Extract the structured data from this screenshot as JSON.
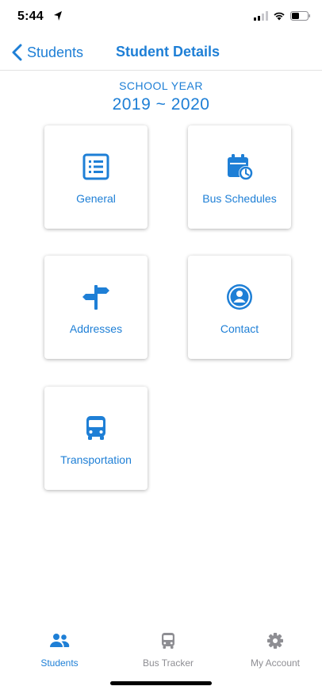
{
  "status_bar": {
    "time": "5:44"
  },
  "nav": {
    "back_label": "Students",
    "title": "Student Details"
  },
  "school_year": {
    "label": "SCHOOL YEAR",
    "value": "2019 ~ 2020"
  },
  "tiles": [
    {
      "label": "General",
      "icon": "list-icon"
    },
    {
      "label": "Bus Schedules",
      "icon": "calendar-clock-icon"
    },
    {
      "label": "Addresses",
      "icon": "signpost-icon"
    },
    {
      "label": "Contact",
      "icon": "user-circle-icon"
    },
    {
      "label": "Transportation",
      "icon": "bus-icon"
    }
  ],
  "tab_bar": {
    "items": [
      {
        "label": "Students",
        "icon": "users-icon",
        "active": true
      },
      {
        "label": "Bus Tracker",
        "icon": "bus-icon",
        "active": false
      },
      {
        "label": "My Account",
        "icon": "gear-icon",
        "active": false
      }
    ]
  },
  "colors": {
    "accent": "#1e7fd6",
    "inactive": "#8e8e93",
    "background": "#ffffff"
  }
}
